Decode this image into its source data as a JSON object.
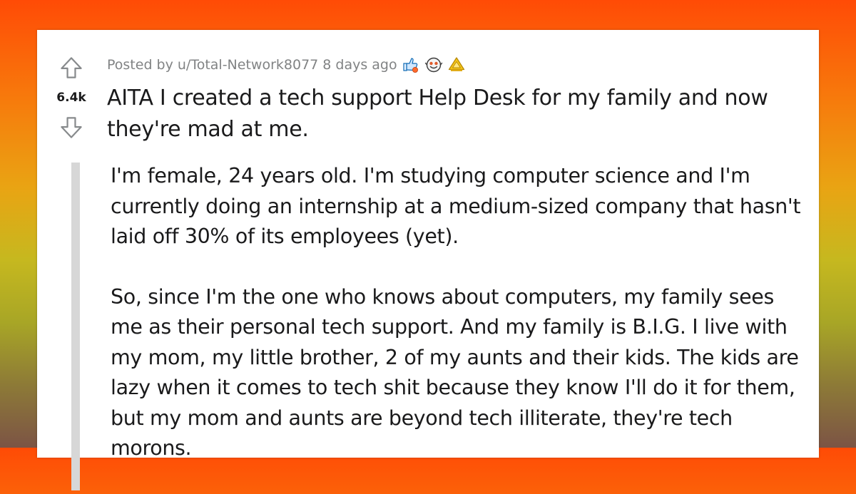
{
  "post": {
    "score": "6.4k",
    "posted_by": "Posted by u/Total-Network8077",
    "time_ago": "8 days ago",
    "title": "AITA I created a tech support Help Desk for my family and now they're mad at me.",
    "paragraphs": [
      "I'm female, 24 years old. I'm studying computer science and I'm currently doing an internship at a medium-sized company that hasn't laid off 30% of its employees (yet).",
      "So, since I'm the one who knows about computers, my family sees me as their personal tech support. And my family is B.I.G. I live with my mom, my little brother, 2 of my aunts and their kids. The kids are lazy when it comes to tech shit because they know I'll do it for them, but my mom and aunts are beyond tech illiterate, they're tech morons."
    ],
    "awards": [
      "helpful-award-icon",
      "wholesome-award-icon",
      "gold-award-icon"
    ]
  },
  "colors": {
    "background_top": "#ff4b06",
    "background_bottom": "#7c5445",
    "vote_arrow": "#878a8c",
    "meta_text": "#818384",
    "body_text": "#1a1a1b",
    "quote_bar": "#d7d7d7"
  }
}
